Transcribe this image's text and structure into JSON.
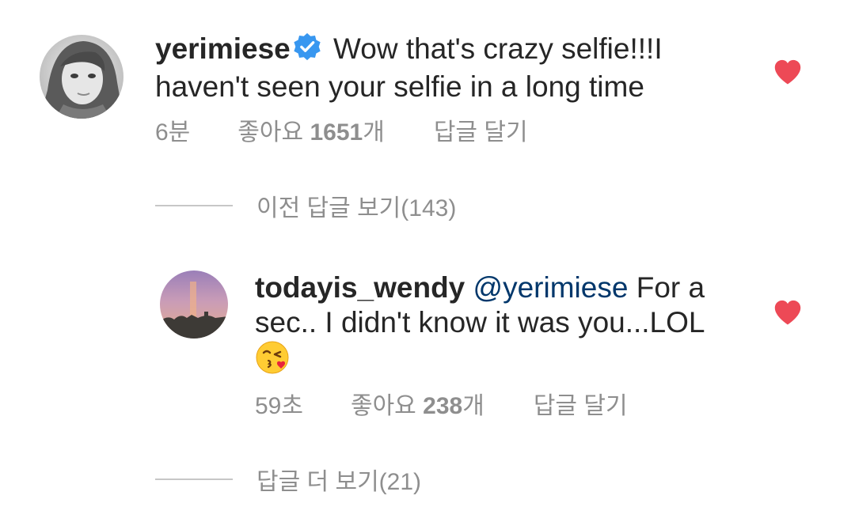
{
  "comment": {
    "username": "yerimiese",
    "verified_icon": "verified-badge-icon",
    "text": "Wow that's crazy selfie!!!I haven't seen your selfie in a long time",
    "text_line1": "Wow that's crazy selfie!!!I",
    "text_line2": "haven't seen your selfie in a long time",
    "time": "6분",
    "likes_label": "좋아요",
    "likes_count": "1651",
    "likes_unit": "개",
    "reply_label": "답글 달기",
    "liked": true
  },
  "previous_replies": {
    "label": "이전 답글 보기(143)"
  },
  "reply": {
    "username": "todayis_wendy",
    "mention": "@yerimiese",
    "text_line1": "For a",
    "text_line2": "sec.. I didn't know it was you...LOL",
    "emoji": "face-blowing-kiss",
    "time": "59초",
    "likes_label": "좋아요",
    "likes_count": "238",
    "likes_unit": "개",
    "reply_label": "답글 달기",
    "liked": true
  },
  "more_replies": {
    "label": "답글 더 보기(21)"
  },
  "colors": {
    "heart": "#ed4956",
    "verified": "#3897f0",
    "mention": "#00376b",
    "secondary_text": "#8e8e8e"
  }
}
